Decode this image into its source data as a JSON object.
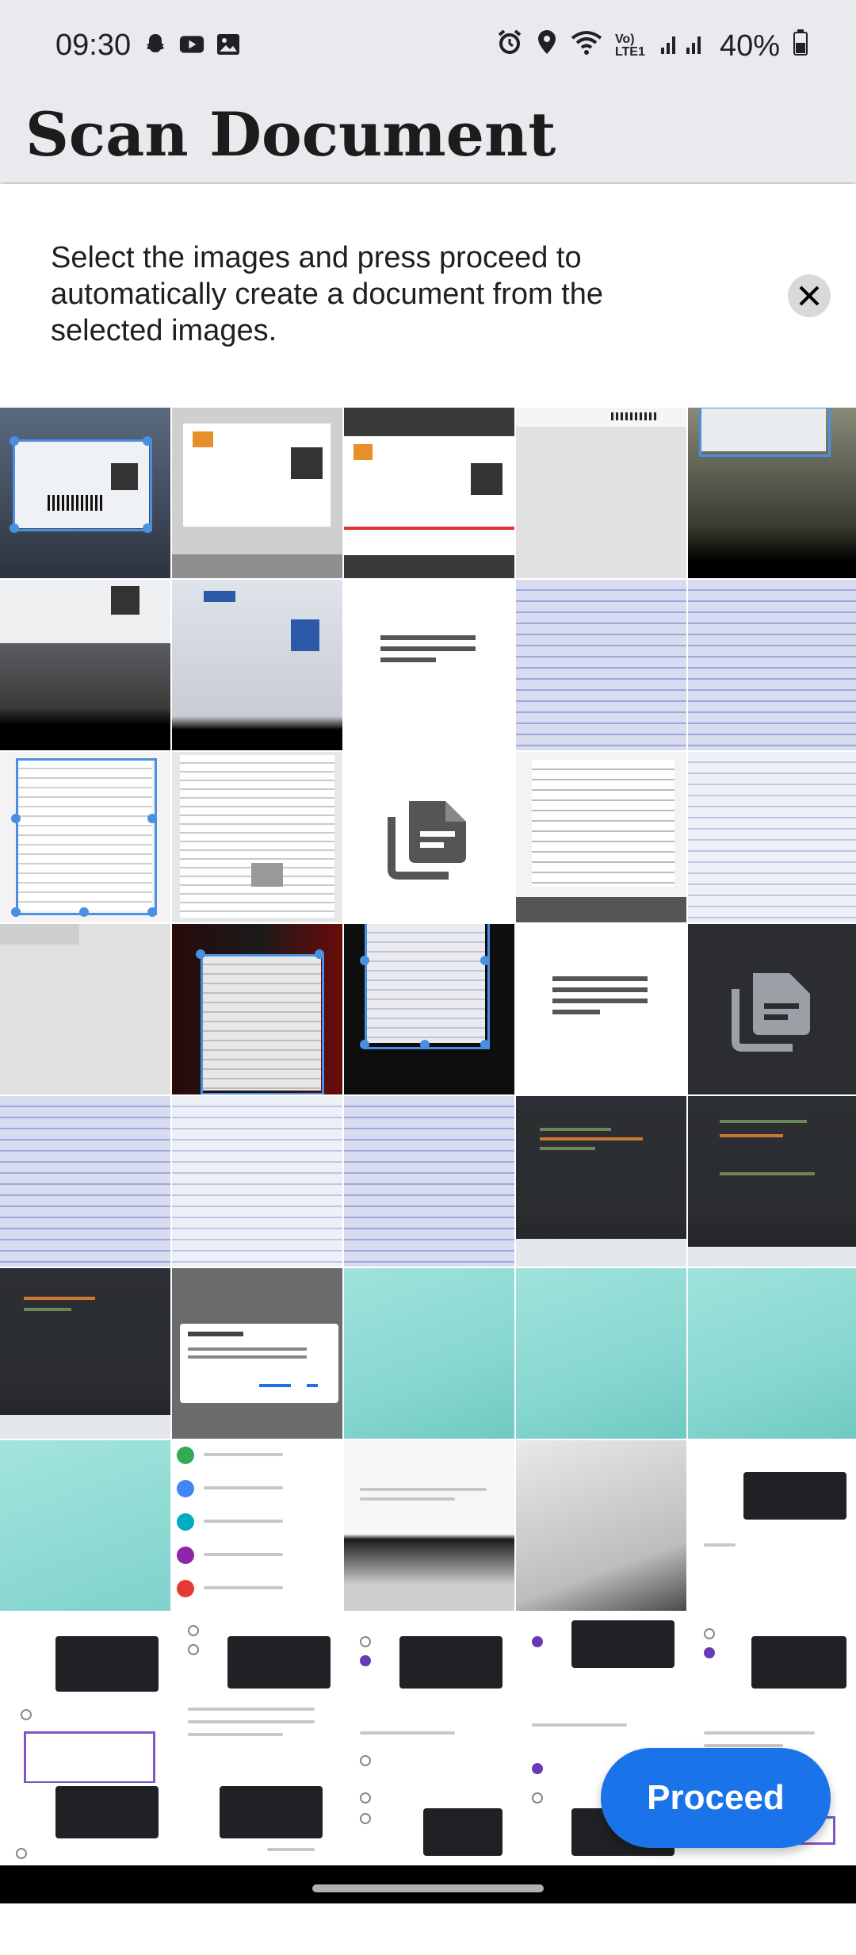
{
  "status": {
    "time": "09:30",
    "battery": "40%",
    "net_label": "Vo) LTE1"
  },
  "app": {
    "title": "Scan Document"
  },
  "banner": {
    "message": "Select the images and press proceed to automatically create a document from the selected images."
  },
  "actions": {
    "proceed_label": "Proceed"
  },
  "icons": {
    "status_left": [
      "snapchat-icon",
      "youtube-icon",
      "gallery-icon"
    ],
    "status_right": [
      "alarm-icon",
      "location-icon",
      "wifi-icon",
      "signal-icon",
      "battery-icon"
    ],
    "close": "close-icon",
    "document_placeholder": "document-icon"
  },
  "colors": {
    "accent": "#1a73e8",
    "appbar": "#e8eaed"
  }
}
